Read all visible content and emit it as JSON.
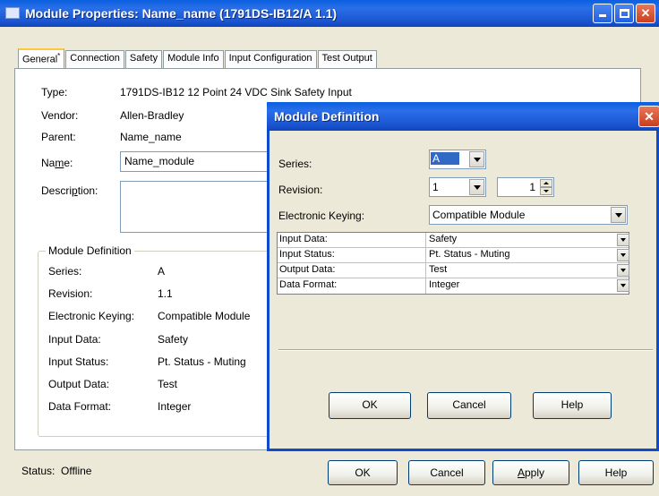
{
  "window": {
    "title": "Module Properties: Name_name (1791DS-IB12/A 1.1)"
  },
  "tabs": [
    {
      "label": "General",
      "marker": "*"
    },
    {
      "label": "Connection"
    },
    {
      "label": "Safety"
    },
    {
      "label": "Module Info"
    },
    {
      "label": "Input Configuration"
    },
    {
      "label": "Test Output"
    }
  ],
  "general": {
    "type_label": "Type:",
    "type_value": "1791DS-IB12 12 Point 24 VDC Sink Safety Input",
    "vendor_label": "Vendor:",
    "vendor_value": "Allen-Bradley",
    "parent_label": "Parent:",
    "parent_value": "Name_name",
    "name_label_pre": "Na",
    "name_label_u": "m",
    "name_label_post": "e:",
    "name_value": "Name_module",
    "desc_label_pre": "Descri",
    "desc_label_u": "p",
    "desc_label_post": "tion:",
    "desc_value": ""
  },
  "module_definition_summary": {
    "legend": "Module Definition",
    "rows": [
      {
        "label": "Series:",
        "value": "A"
      },
      {
        "label": "Revision:",
        "value": "1.1"
      },
      {
        "label": "Electronic Keying:",
        "value": "Compatible Module"
      },
      {
        "label": "Input Data:",
        "value": "Safety"
      },
      {
        "label": "Input Status:",
        "value": "Pt. Status - Muting"
      },
      {
        "label": "Output Data:",
        "value": "Test"
      },
      {
        "label": "Data Format:",
        "value": "Integer"
      }
    ]
  },
  "status": {
    "label": "Status:",
    "value": "Offline"
  },
  "main_buttons": {
    "ok": "OK",
    "cancel": "Cancel",
    "apply_u": "A",
    "apply_rest": "pply",
    "help": "Help"
  },
  "dialog": {
    "title": "Module Definition",
    "series_label": "Series:",
    "series_value": "A",
    "revision_label": "Revision:",
    "revision_major": "1",
    "revision_minor": "1",
    "keying_label": "Electronic Keying:",
    "keying_value": "Compatible Module",
    "grid": [
      {
        "label": "Input Data:",
        "value": "Safety"
      },
      {
        "label": "Input Status:",
        "value": "Pt. Status - Muting"
      },
      {
        "label": "Output Data:",
        "value": "Test"
      },
      {
        "label": "Data Format:",
        "value": "Integer"
      }
    ],
    "buttons": {
      "ok": "OK",
      "cancel": "Cancel",
      "help": "Help"
    }
  },
  "colors": {
    "titlebar": "#1a55d0",
    "face": "#ece9d8",
    "selection": "#316ac5"
  }
}
